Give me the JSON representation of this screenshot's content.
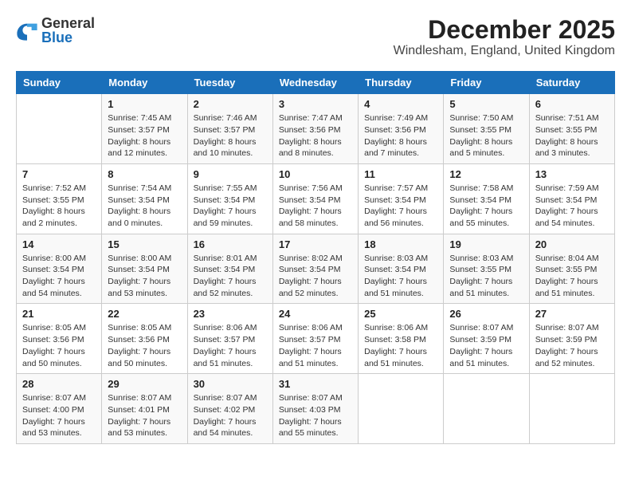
{
  "logo": {
    "text_general": "General",
    "text_blue": "Blue"
  },
  "title": "December 2025",
  "location": "Windlesham, England, United Kingdom",
  "weekdays": [
    "Sunday",
    "Monday",
    "Tuesday",
    "Wednesday",
    "Thursday",
    "Friday",
    "Saturday"
  ],
  "weeks": [
    [
      {
        "day": "",
        "info": ""
      },
      {
        "day": "1",
        "info": "Sunrise: 7:45 AM\nSunset: 3:57 PM\nDaylight: 8 hours\nand 12 minutes."
      },
      {
        "day": "2",
        "info": "Sunrise: 7:46 AM\nSunset: 3:57 PM\nDaylight: 8 hours\nand 10 minutes."
      },
      {
        "day": "3",
        "info": "Sunrise: 7:47 AM\nSunset: 3:56 PM\nDaylight: 8 hours\nand 8 minutes."
      },
      {
        "day": "4",
        "info": "Sunrise: 7:49 AM\nSunset: 3:56 PM\nDaylight: 8 hours\nand 7 minutes."
      },
      {
        "day": "5",
        "info": "Sunrise: 7:50 AM\nSunset: 3:55 PM\nDaylight: 8 hours\nand 5 minutes."
      },
      {
        "day": "6",
        "info": "Sunrise: 7:51 AM\nSunset: 3:55 PM\nDaylight: 8 hours\nand 3 minutes."
      }
    ],
    [
      {
        "day": "7",
        "info": "Sunrise: 7:52 AM\nSunset: 3:55 PM\nDaylight: 8 hours\nand 2 minutes."
      },
      {
        "day": "8",
        "info": "Sunrise: 7:54 AM\nSunset: 3:54 PM\nDaylight: 8 hours\nand 0 minutes."
      },
      {
        "day": "9",
        "info": "Sunrise: 7:55 AM\nSunset: 3:54 PM\nDaylight: 7 hours\nand 59 minutes."
      },
      {
        "day": "10",
        "info": "Sunrise: 7:56 AM\nSunset: 3:54 PM\nDaylight: 7 hours\nand 58 minutes."
      },
      {
        "day": "11",
        "info": "Sunrise: 7:57 AM\nSunset: 3:54 PM\nDaylight: 7 hours\nand 56 minutes."
      },
      {
        "day": "12",
        "info": "Sunrise: 7:58 AM\nSunset: 3:54 PM\nDaylight: 7 hours\nand 55 minutes."
      },
      {
        "day": "13",
        "info": "Sunrise: 7:59 AM\nSunset: 3:54 PM\nDaylight: 7 hours\nand 54 minutes."
      }
    ],
    [
      {
        "day": "14",
        "info": "Sunrise: 8:00 AM\nSunset: 3:54 PM\nDaylight: 7 hours\nand 54 minutes."
      },
      {
        "day": "15",
        "info": "Sunrise: 8:00 AM\nSunset: 3:54 PM\nDaylight: 7 hours\nand 53 minutes."
      },
      {
        "day": "16",
        "info": "Sunrise: 8:01 AM\nSunset: 3:54 PM\nDaylight: 7 hours\nand 52 minutes."
      },
      {
        "day": "17",
        "info": "Sunrise: 8:02 AM\nSunset: 3:54 PM\nDaylight: 7 hours\nand 52 minutes."
      },
      {
        "day": "18",
        "info": "Sunrise: 8:03 AM\nSunset: 3:54 PM\nDaylight: 7 hours\nand 51 minutes."
      },
      {
        "day": "19",
        "info": "Sunrise: 8:03 AM\nSunset: 3:55 PM\nDaylight: 7 hours\nand 51 minutes."
      },
      {
        "day": "20",
        "info": "Sunrise: 8:04 AM\nSunset: 3:55 PM\nDaylight: 7 hours\nand 51 minutes."
      }
    ],
    [
      {
        "day": "21",
        "info": "Sunrise: 8:05 AM\nSunset: 3:56 PM\nDaylight: 7 hours\nand 50 minutes."
      },
      {
        "day": "22",
        "info": "Sunrise: 8:05 AM\nSunset: 3:56 PM\nDaylight: 7 hours\nand 50 minutes."
      },
      {
        "day": "23",
        "info": "Sunrise: 8:06 AM\nSunset: 3:57 PM\nDaylight: 7 hours\nand 51 minutes."
      },
      {
        "day": "24",
        "info": "Sunrise: 8:06 AM\nSunset: 3:57 PM\nDaylight: 7 hours\nand 51 minutes."
      },
      {
        "day": "25",
        "info": "Sunrise: 8:06 AM\nSunset: 3:58 PM\nDaylight: 7 hours\nand 51 minutes."
      },
      {
        "day": "26",
        "info": "Sunrise: 8:07 AM\nSunset: 3:59 PM\nDaylight: 7 hours\nand 51 minutes."
      },
      {
        "day": "27",
        "info": "Sunrise: 8:07 AM\nSunset: 3:59 PM\nDaylight: 7 hours\nand 52 minutes."
      }
    ],
    [
      {
        "day": "28",
        "info": "Sunrise: 8:07 AM\nSunset: 4:00 PM\nDaylight: 7 hours\nand 53 minutes."
      },
      {
        "day": "29",
        "info": "Sunrise: 8:07 AM\nSunset: 4:01 PM\nDaylight: 7 hours\nand 53 minutes."
      },
      {
        "day": "30",
        "info": "Sunrise: 8:07 AM\nSunset: 4:02 PM\nDaylight: 7 hours\nand 54 minutes."
      },
      {
        "day": "31",
        "info": "Sunrise: 8:07 AM\nSunset: 4:03 PM\nDaylight: 7 hours\nand 55 minutes."
      },
      {
        "day": "",
        "info": ""
      },
      {
        "day": "",
        "info": ""
      },
      {
        "day": "",
        "info": ""
      }
    ]
  ]
}
